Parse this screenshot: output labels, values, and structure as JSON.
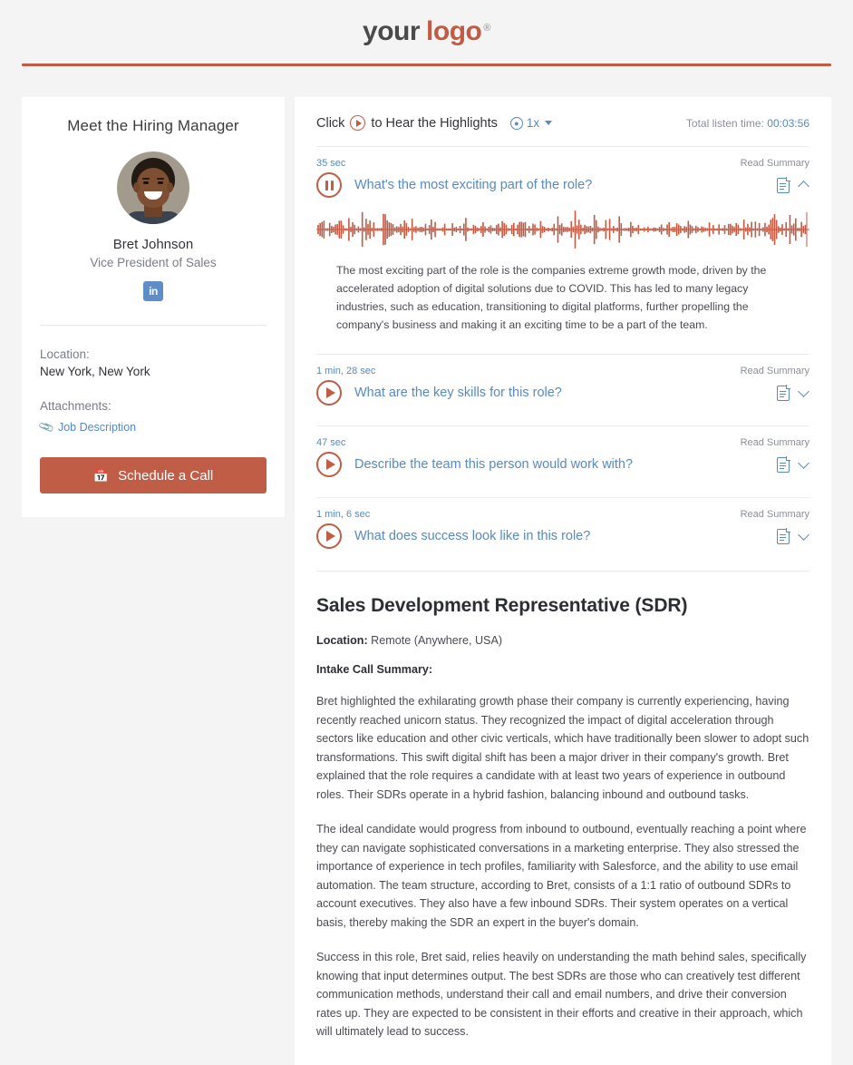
{
  "header": {
    "logo_first": "your",
    "logo_second": "logo",
    "logo_mark": "®"
  },
  "profile": {
    "section_title": "Meet the Hiring Manager",
    "name": "Bret Johnson",
    "title": "Vice President of Sales",
    "social_icon_label": "in",
    "location_label": "Location:",
    "location_value": "New York, New York",
    "attachments_label": "Attachments:",
    "attachment_name": "Job Description",
    "schedule_button": "Schedule a Call"
  },
  "highlights": {
    "click_prefix": "Click",
    "click_suffix": "to Hear the Highlights",
    "speed": "1x",
    "speed_icon_glyph": "Ⓣ",
    "total_listen_label": "Total listen time:",
    "total_listen_value": "00:03:56",
    "read_summary_label": "Read Summary",
    "items": [
      {
        "duration": "35 sec",
        "question": "What's the most exciting part of the role?",
        "state": "playing",
        "expanded": true,
        "summary": "The most exciting part of the role is the companies extreme growth mode, driven by the accelerated adoption of digital solutions due to COVID. This has led to many legacy industries, such as education, transitioning to digital platforms, further propelling the company's business and making it an exciting time to be a part of the team."
      },
      {
        "duration": "1 min, 28 sec",
        "question": "What are the key skills for this role?",
        "state": "paused",
        "expanded": false,
        "summary": ""
      },
      {
        "duration": "47 sec",
        "question": "Describe the team this person would work with?",
        "state": "paused",
        "expanded": false,
        "summary": ""
      },
      {
        "duration": "1 min, 6 sec",
        "question": "What does success look like in this role?",
        "state": "paused",
        "expanded": false,
        "summary": ""
      }
    ]
  },
  "job": {
    "title": "Sales Development Representative (SDR)",
    "location_label": "Location:",
    "location_value": "Remote (Anywhere, USA)",
    "summary_label": "Intake Call Summary:",
    "paragraphs": [
      "Bret highlighted the exhilarating growth phase their company is currently experiencing, having recently reached unicorn status. They recognized the impact of digital acceleration through sectors like education and other civic verticals, which have traditionally been slower to adopt such transformations. This swift digital shift has been a major driver in their company's growth. Bret explained that the role requires a candidate with at least two years of experience in outbound roles. Their SDRs operate in a hybrid fashion, balancing inbound and outbound tasks.",
      "The ideal candidate would progress from inbound to outbound, eventually reaching a point where they can navigate sophisticated conversations in a marketing enterprise. They also stressed the importance of experience in tech profiles, familiarity with Salesforce, and the ability to use email automation. The team structure, according to Bret, consists of a 1:1 ratio of outbound SDRs to account executives. They also have a few inbound SDRs. Their system operates on a vertical basis, thereby making the SDR an expert in the buyer's domain.",
      "Success in this role, Bret said, relies heavily on understanding the math behind sales, specifically knowing that input determines output. The best SDRs are those who can creatively test different communication methods, understand their call and email numbers, and drive their conversion rates up. They are expected to be consistent in their efforts and creative in their approach, which will ultimately lead to success."
    ]
  },
  "colors": {
    "brand_red": "#c25b44",
    "link_blue": "#5789c4",
    "button_red": "#bf5d47",
    "page_bg": "#f4f4f4"
  }
}
